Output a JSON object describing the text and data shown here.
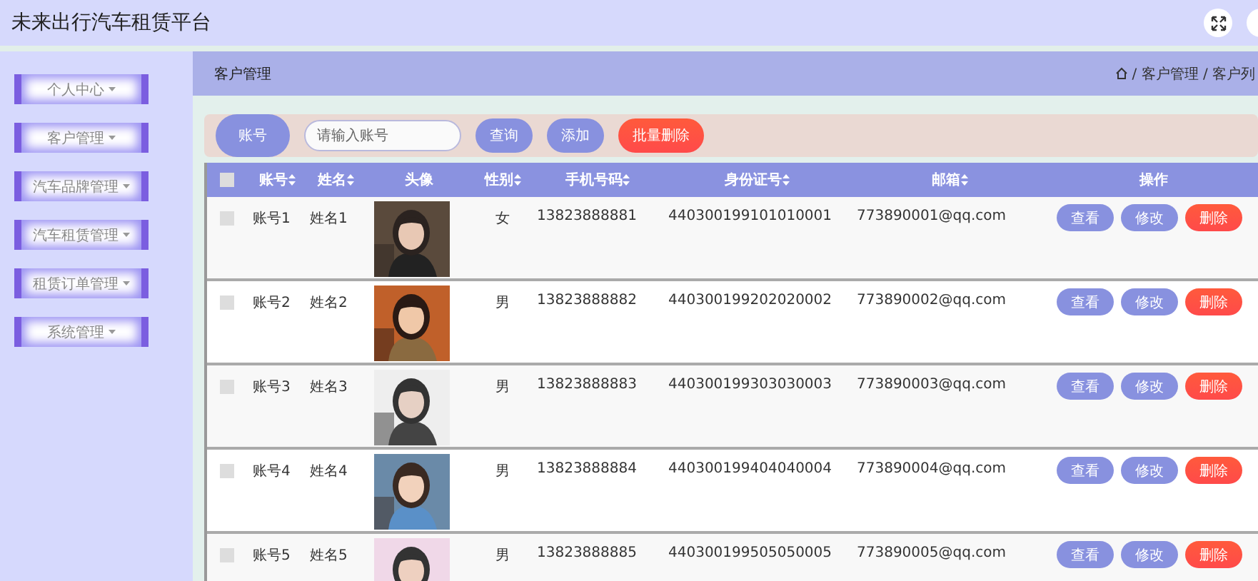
{
  "window": {
    "title": "未来出行汽车租赁平台"
  },
  "sidebar": {
    "items": [
      {
        "label": "个人中心"
      },
      {
        "label": "客户管理"
      },
      {
        "label": "汽车品牌管理"
      },
      {
        "label": "汽车租赁管理"
      },
      {
        "label": "租赁订单管理"
      },
      {
        "label": "系统管理"
      }
    ]
  },
  "page_header": {
    "title": "客户管理",
    "breadcrumb": "/ 客户管理 / 客户列"
  },
  "search": {
    "label": "账号",
    "placeholder": "请输入账号",
    "buttons": [
      {
        "label": "查询",
        "kind": "primary"
      },
      {
        "label": "添加",
        "kind": "primary"
      },
      {
        "label": "批量删除",
        "kind": "danger"
      }
    ]
  },
  "table": {
    "select_all_checked": false,
    "columns": [
      {
        "label": "账号",
        "sortable": true
      },
      {
        "label": "姓名",
        "sortable": true
      },
      {
        "label": "头像",
        "sortable": false
      },
      {
        "label": "性别",
        "sortable": true
      },
      {
        "label": "手机号码",
        "sortable": true
      },
      {
        "label": "身份证号",
        "sortable": true
      },
      {
        "label": "邮箱",
        "sortable": true
      },
      {
        "label": "操作",
        "sortable": false
      }
    ],
    "rows": [
      {
        "checked": false,
        "account": "账号1",
        "name": "姓名1",
        "gender": "女",
        "phone": "13823888881",
        "id_number": "440300199101010001",
        "email": "773890001@qq.com",
        "actions": [
          {
            "label": "查看",
            "kind": "primary"
          },
          {
            "label": "修改",
            "kind": "primary"
          },
          {
            "label": "删除",
            "kind": "danger"
          }
        ]
      },
      {
        "checked": false,
        "account": "账号2",
        "name": "姓名2",
        "gender": "男",
        "phone": "13823888882",
        "id_number": "440300199202020002",
        "email": "773890002@qq.com",
        "actions": [
          {
            "label": "查看",
            "kind": "primary"
          },
          {
            "label": "修改",
            "kind": "primary"
          },
          {
            "label": "删除",
            "kind": "danger"
          }
        ]
      },
      {
        "checked": false,
        "account": "账号3",
        "name": "姓名3",
        "gender": "男",
        "phone": "13823888883",
        "id_number": "440300199303030003",
        "email": "773890003@qq.com",
        "actions": [
          {
            "label": "查看",
            "kind": "primary"
          },
          {
            "label": "修改",
            "kind": "primary"
          },
          {
            "label": "删除",
            "kind": "danger"
          }
        ]
      },
      {
        "checked": false,
        "account": "账号4",
        "name": "姓名4",
        "gender": "男",
        "phone": "13823888884",
        "id_number": "440300199404040004",
        "email": "773890004@qq.com",
        "actions": [
          {
            "label": "查看",
            "kind": "primary"
          },
          {
            "label": "修改",
            "kind": "primary"
          },
          {
            "label": "删除",
            "kind": "danger"
          }
        ]
      },
      {
        "checked": false,
        "account": "账号5",
        "name": "姓名5",
        "gender": "男",
        "phone": "13823888885",
        "id_number": "440300199505050005",
        "email": "773890005@qq.com",
        "actions": [
          {
            "label": "查看",
            "kind": "primary"
          },
          {
            "label": "修改",
            "kind": "primary"
          },
          {
            "label": "删除",
            "kind": "danger"
          }
        ]
      }
    ]
  }
}
